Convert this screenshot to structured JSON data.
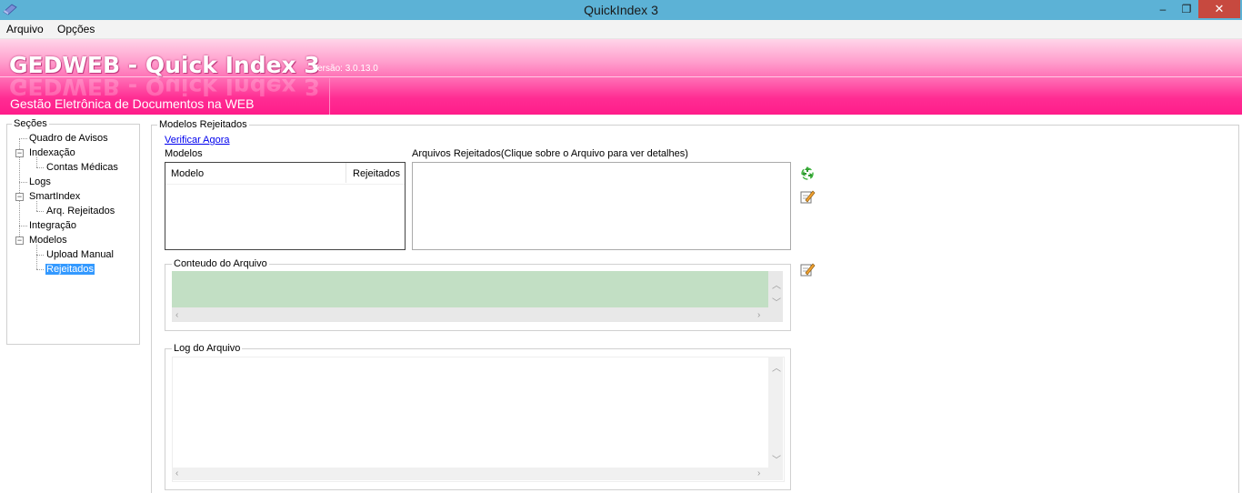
{
  "window": {
    "title": "QuickIndex 3",
    "minimize": "‒",
    "maximize": "❐",
    "close": "✕"
  },
  "menu": {
    "items": [
      "Arquivo",
      "Opções"
    ]
  },
  "banner": {
    "title": "GEDWEB - Quick Index 3",
    "version": "Versão:  3.0.13.0",
    "subtitle": "Gestão Eletrônica de Documentos na WEB"
  },
  "sections": {
    "legend": "Seções",
    "items": [
      "Quadro de Avisos",
      "Indexação",
      "Contas Médicas",
      "Logs",
      "SmartIndex",
      "Arq. Rejeitados",
      "Integração",
      "Modelos",
      "Upload Manual",
      "Rejeitados"
    ],
    "selected": "Rejeitados"
  },
  "main": {
    "legend": "Modelos Rejeitados",
    "verify_link": "Verificar Agora",
    "models_label": "Modelos",
    "models_columns": [
      "Modelo",
      "Rejeitados"
    ],
    "rejected_label": "Arquivos Rejeitados(Clique sobre o Arquivo para ver detalhes)",
    "content_legend": "Conteudo do Arquivo",
    "log_legend": "Log do Arquivo"
  },
  "colors": {
    "titlebar": "#5cb2d6",
    "banner_accent": "#ff1c8a",
    "selection": "#3399ff",
    "content_fill": "#c2dfc4"
  },
  "icons": [
    "recycle-icon",
    "edit-note-icon",
    "edit-note-icon"
  ]
}
